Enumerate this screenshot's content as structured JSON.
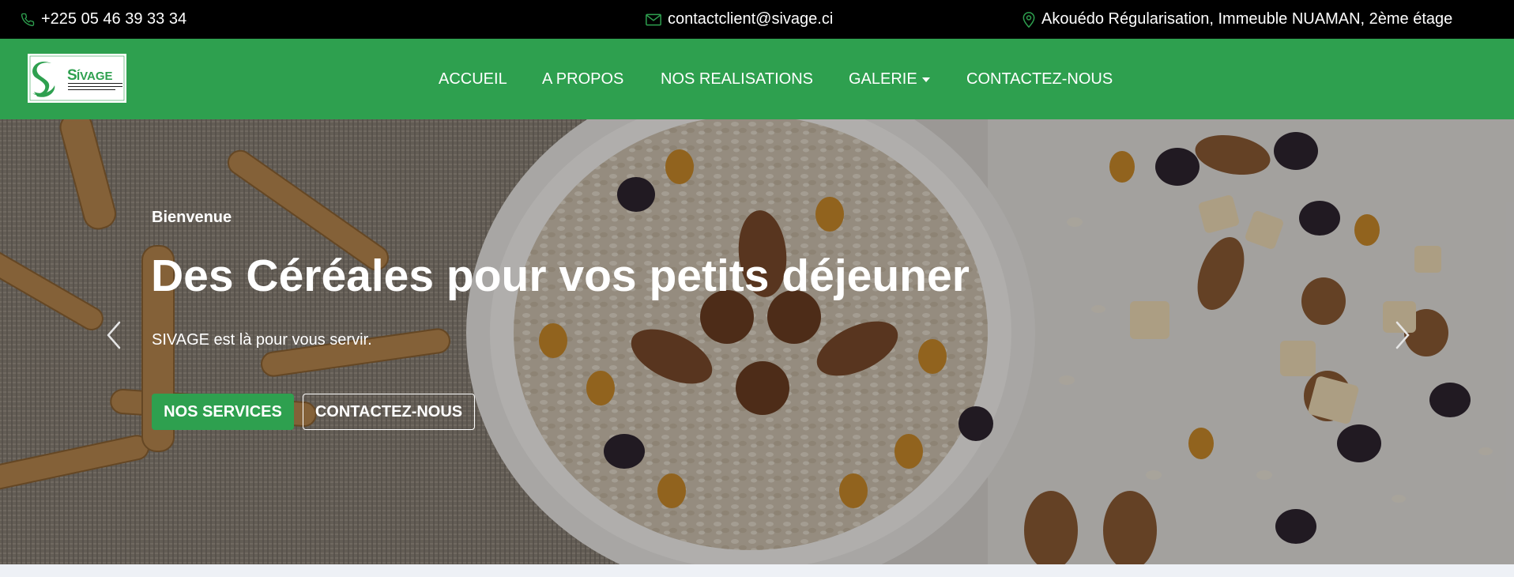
{
  "topbar": {
    "phone": "+225 05 46 39 33 34",
    "email": "contactclient@sivage.ci",
    "address": "Akouédo Régularisation, Immeuble NUAMAN, 2ème étage",
    "icons": {
      "phone": "phone-icon",
      "email": "envelope-icon",
      "address": "map-pin-icon"
    },
    "icon_color": "#2ea04f"
  },
  "brand": {
    "name": "SIVAGE",
    "tagline": "Société Ivoirienne pour la Valorisation de l'Agriculture et de l'Elevage",
    "color": "#2ea04f"
  },
  "nav": {
    "items": [
      {
        "label": "ACCUEIL"
      },
      {
        "label": "A PROPOS"
      },
      {
        "label": "NOS REALISATIONS"
      },
      {
        "label": "GALERIE",
        "has_dropdown": true
      },
      {
        "label": "CONTACTEZ-NOUS"
      }
    ]
  },
  "hero": {
    "kicker": "Bienvenue",
    "title": "Des Céréales pour vos petits déjeuner",
    "subtitle": "SIVAGE est là pour vous servir.",
    "primary_button": "NOS SERVICES",
    "secondary_button": "CONTACTEZ-NOUS",
    "icons": {
      "prev": "chevron-left-icon",
      "next": "chevron-right-icon"
    }
  }
}
